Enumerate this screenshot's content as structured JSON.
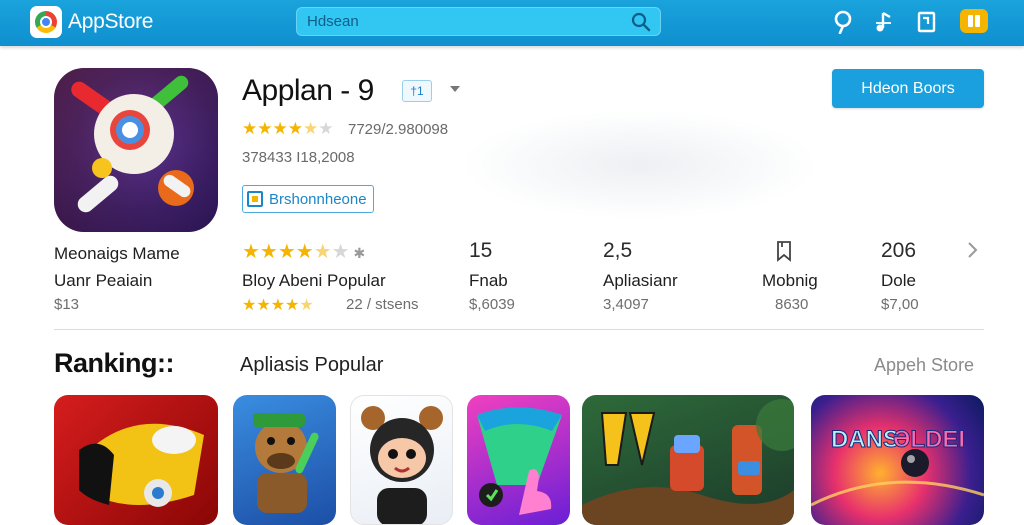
{
  "header": {
    "brand": "AppStore",
    "search_placeholder": "Hdsean",
    "accent": "#0f8fcf"
  },
  "app": {
    "title": "Applan - 9",
    "badge": "†1",
    "rating_text": "7729/2.980098",
    "sub_text": "378433 I18,2008",
    "tag": "Brshonnheone",
    "cta": "Hdeon Boors"
  },
  "stats": {
    "left_title": "Meonaigs Mame",
    "left_label": "Uanr Peaiain",
    "left_value": "$13",
    "rating": {
      "label": "Bloy Abeni Popular",
      "sub": "22 / stsens"
    },
    "col2": {
      "big": "15",
      "label": "Fnab",
      "sub": "$,6039"
    },
    "col3": {
      "big": "2,5",
      "label": "Apliasianr",
      "sub": "3,4097"
    },
    "col4": {
      "icon": "bookmark-icon",
      "label": "Mobnig",
      "sub": "8630"
    },
    "col5": {
      "big": "206",
      "label": "Dole",
      "sub": "$7,00"
    }
  },
  "ranking": {
    "title": "Ranking::",
    "subtitle": "Apliasis Popular",
    "link": "Appeh Store"
  }
}
